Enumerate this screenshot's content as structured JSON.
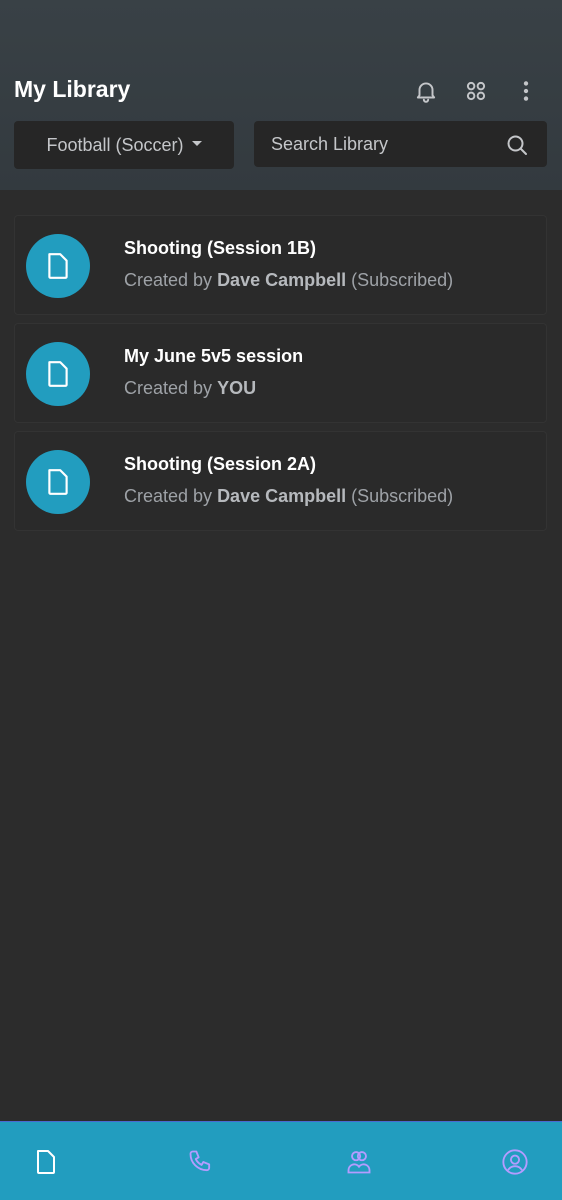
{
  "header": {
    "title": "My Library",
    "icons": [
      "bell-icon",
      "grid-icon",
      "more-vertical-icon"
    ],
    "filter": {
      "label": "Football (Soccer)"
    },
    "search": {
      "placeholder": "Search Library",
      "value": ""
    }
  },
  "items": [
    {
      "title": "Shooting (Session 1B)",
      "prefix": "Created by ",
      "author": "Dave Campbell",
      "suffix": " (Subscribed)"
    },
    {
      "title": "My June 5v5 session",
      "prefix": "Created by ",
      "author": "YOU",
      "suffix": ""
    },
    {
      "title": "Shooting (Session 2A)",
      "prefix": "Created by ",
      "author": "Dave Campbell",
      "suffix": " (Subscribed)"
    }
  ],
  "nav": {
    "items": [
      {
        "icon": "document-icon",
        "active": true
      },
      {
        "icon": "phone-icon",
        "active": false
      },
      {
        "icon": "users-icon",
        "active": false
      },
      {
        "icon": "profile-icon",
        "active": false
      }
    ]
  },
  "colors": {
    "accent": "#229dbf",
    "inactive_icon": "#b49cff",
    "background": "#2c2c2c"
  }
}
